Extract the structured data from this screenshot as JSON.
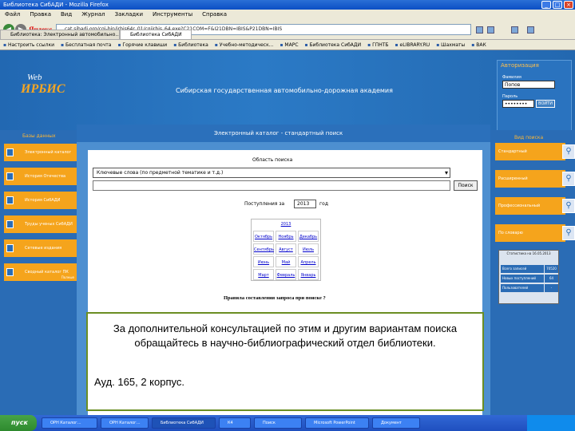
{
  "browser": {
    "title": "Библиотека СибАДИ - Mozilla Firefox",
    "menu": [
      "Файл",
      "Правка",
      "Вид",
      "Журнал",
      "Закладки",
      "Инструменты",
      "Справка"
    ],
    "search_brand": "Яндекс",
    "url": "cat.sibadi.org/cgi-bin/irbis64r_01/cgiirbis_64.exe?C21COM=F&I21DBN=IBIS&P21DBN=IBIS",
    "tabs": [
      "Библиотека: Электронный автомобильно...",
      "Библиотека СибАДИ"
    ],
    "bookmarks": [
      "Настроить ссылки",
      "Бесплатная почта",
      "Горячие клавиши",
      "Библиотека",
      "Учебно-методическ...",
      "МАРС",
      "Библиотека СибАДИ",
      "ГПНТБ",
      "eLIBRARY.RU",
      "Шахматы",
      "ВАК"
    ]
  },
  "site": {
    "logo_web": "Web",
    "logo_irbis": "ИРБИС",
    "academy_title": "Сибирская государственная автомобильно-дорожная академия",
    "auth": {
      "title": "Авторизация",
      "surname_label": "Фамилия",
      "surname_value": "Попов",
      "password_label": "Пароль",
      "password_value": "••••••••",
      "login_button": "ВОЙТИ"
    },
    "left": {
      "heading": "Базы данных",
      "items": [
        {
          "label": "Электронный каталог",
          "sub": ""
        },
        {
          "label": "История Отечества",
          "sub": ""
        },
        {
          "label": "История СибАДИ",
          "sub": ""
        },
        {
          "label": "Труды ученых СибАДИ",
          "sub": ""
        },
        {
          "label": "Сетевые издания",
          "sub": ""
        },
        {
          "label": "Сводный каталог ПК",
          "sub": "Полные"
        }
      ]
    },
    "right": {
      "heading": "Вид поиска",
      "items": [
        "Стандартный",
        "Расширенный",
        "Профессиональный",
        "По словарю"
      ],
      "stats": {
        "head": "Статистика на 16.05.2013",
        "rows": [
          {
            "k": "Всего записей",
            "v": "70520"
          },
          {
            "k": "Новых поступлений",
            "v": "64"
          },
          {
            "k": "Пользователей",
            "v": "-"
          }
        ]
      }
    },
    "center": {
      "heading": "Электронный каталог - стандартный поиск",
      "search_area_label": "Область поиска",
      "search_select_value": "Ключевые слова (по предметной тематике и т.д.)",
      "find_button": "Поиск",
      "arrivals_label": "Поступления за",
      "year_value": "2013",
      "year_suffix": "год",
      "months_year": "2013",
      "months": [
        "Октябрь",
        "Ноябрь",
        "Декабрь",
        "Сентябрь",
        "Август",
        "Июль",
        "Июнь",
        "Май",
        "Апрель",
        "Март",
        "Февраль",
        "Январь"
      ],
      "rules_link": "Правила составления запроса при поиске ?"
    }
  },
  "callout": {
    "main": "За дополнительной консультацией по этим и другим вариантам поиска обращайтесь в научно-библиографический отдел библиотеки.",
    "room": "Ауд. 165, 2 корпус."
  },
  "taskbar": {
    "start": "пуск",
    "tasks": [
      "ОРН Каталог...",
      "ОРН Каталог...",
      "Библиотека СибАДИ",
      "К4",
      "Поиск",
      "Microsoft PowerPoint",
      "Документ"
    ]
  }
}
